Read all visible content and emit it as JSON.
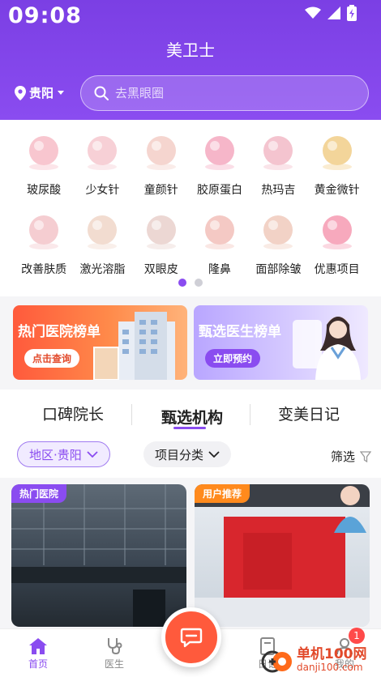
{
  "status": {
    "time": "09:08",
    "icons": [
      "wifi-icon",
      "signal-icon",
      "battery-charging-icon"
    ]
  },
  "header": {
    "title": "美卫士",
    "city": "贵阳",
    "search_placeholder": "去黑眼圈"
  },
  "categories": [
    {
      "label": "玻尿酸",
      "icon": "hyaluronic-acid-icon",
      "color": "#f8c6cf"
    },
    {
      "label": "少女针",
      "icon": "girl-injection-icon",
      "color": "#f7d0d6"
    },
    {
      "label": "童颜针",
      "icon": "youthful-face-icon",
      "color": "#f5d5cf"
    },
    {
      "label": "胶原蛋白",
      "icon": "collagen-icon",
      "color": "#f6b6c9"
    },
    {
      "label": "热玛吉",
      "icon": "thermage-icon",
      "color": "#f4c4cf"
    },
    {
      "label": "黄金微针",
      "icon": "gold-microneedle-icon",
      "color": "#f3d59a"
    },
    {
      "label": "改善肤质",
      "icon": "skin-improve-icon",
      "color": "#f5cdd1"
    },
    {
      "label": "激光溶脂",
      "icon": "laser-lipo-icon",
      "color": "#f2dcd0"
    },
    {
      "label": "双眼皮",
      "icon": "double-eyelid-icon",
      "color": "#ecd7d3"
    },
    {
      "label": "隆鼻",
      "icon": "rhinoplasty-icon",
      "color": "#f4c9c4"
    },
    {
      "label": "面部除皱",
      "icon": "wrinkle-removal-icon",
      "color": "#f2d2c6"
    },
    {
      "label": "优惠项目",
      "icon": "discount-heart-icon",
      "color": "#f7a9bd"
    }
  ],
  "carousel": {
    "pages": 2,
    "current": 1
  },
  "banners": [
    {
      "title": "热门医院榜单",
      "button": "点击查询"
    },
    {
      "title": "甄选医生榜单",
      "button": "立即预约"
    }
  ],
  "tabs": [
    {
      "label": "口碑院长"
    },
    {
      "label": "甄选机构"
    },
    {
      "label": "变美日记"
    }
  ],
  "filters": {
    "area": "地区·贵阳",
    "category": "项目分类",
    "filter": "筛选"
  },
  "cards": [
    {
      "tag": "热门医院"
    },
    {
      "tag": "用户推荐"
    }
  ],
  "nav": [
    {
      "label": "首页",
      "icon": "home-icon"
    },
    {
      "label": "医生",
      "icon": "stethoscope-icon"
    },
    {
      "label": "",
      "icon": "chat-icon"
    },
    {
      "label": "日记",
      "icon": "diary-icon"
    },
    {
      "label": "我的",
      "icon": "profile-icon"
    }
  ],
  "badge_count": "1",
  "watermark": {
    "line1": "单机100网",
    "line2": "danji100.com"
  },
  "colors": {
    "brand": "#8a4cf0",
    "accent": "#ff5a3c"
  }
}
